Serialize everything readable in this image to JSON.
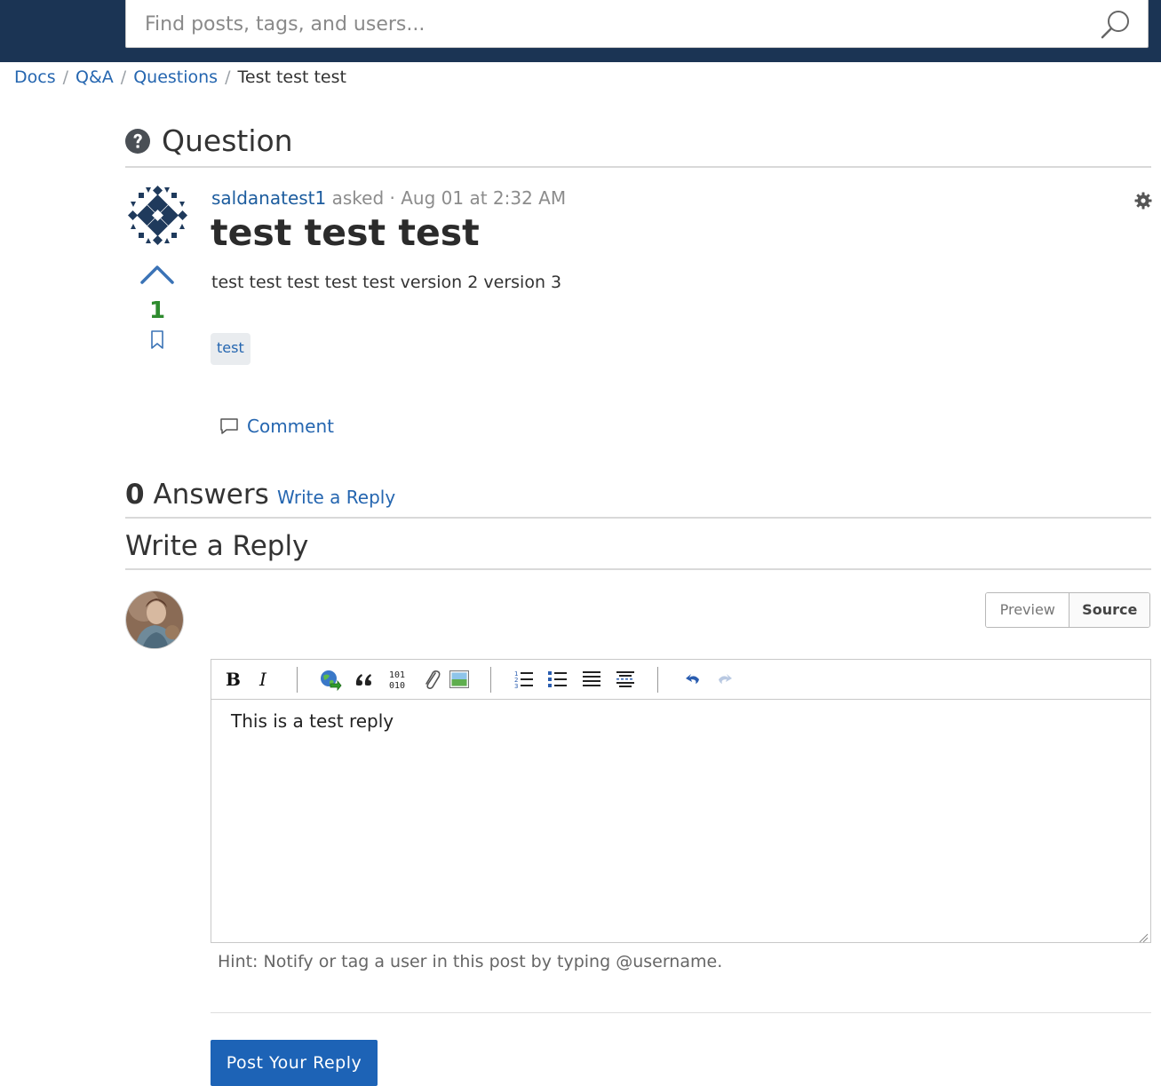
{
  "header": {
    "search_placeholder": "Find posts, tags, and users...",
    "search_icon": "search-icon",
    "bg_color": "#1b3454"
  },
  "breadcrumb": {
    "items": [
      "Docs",
      "Q&A",
      "Questions"
    ],
    "current": "Test test test"
  },
  "section": {
    "title": "Question",
    "icon": "question-circle-icon"
  },
  "question": {
    "author": "saldanatest1",
    "action": "asked",
    "timestamp": "Aug 01 at 2:32 AM",
    "title": "test test test",
    "body": "test test test test test version 2 version 3",
    "votes": "1",
    "tags": [
      "test"
    ],
    "comment_label": "Comment",
    "vote_color": "#2e8b2e"
  },
  "answers": {
    "count": "0",
    "label": "Answers",
    "write_reply_link": "Write a Reply"
  },
  "reply": {
    "title": "Write a Reply",
    "mode_preview": "Preview",
    "mode_source": "Source",
    "active_mode": "Source",
    "content": "This is a test reply",
    "hint": "Hint: Notify or tag a user in this post by typing @username.",
    "submit_label": "Post Your Reply",
    "accent_color": "#1d63b6"
  },
  "toolbar": {
    "buttons": [
      "bold-icon",
      "italic-icon",
      "link-icon",
      "quote-icon",
      "code-icon",
      "attachment-icon",
      "image-icon",
      "ordered-list-icon",
      "bullet-list-icon",
      "justify-icon",
      "horizontal-rule-icon",
      "undo-icon",
      "redo-icon"
    ]
  }
}
